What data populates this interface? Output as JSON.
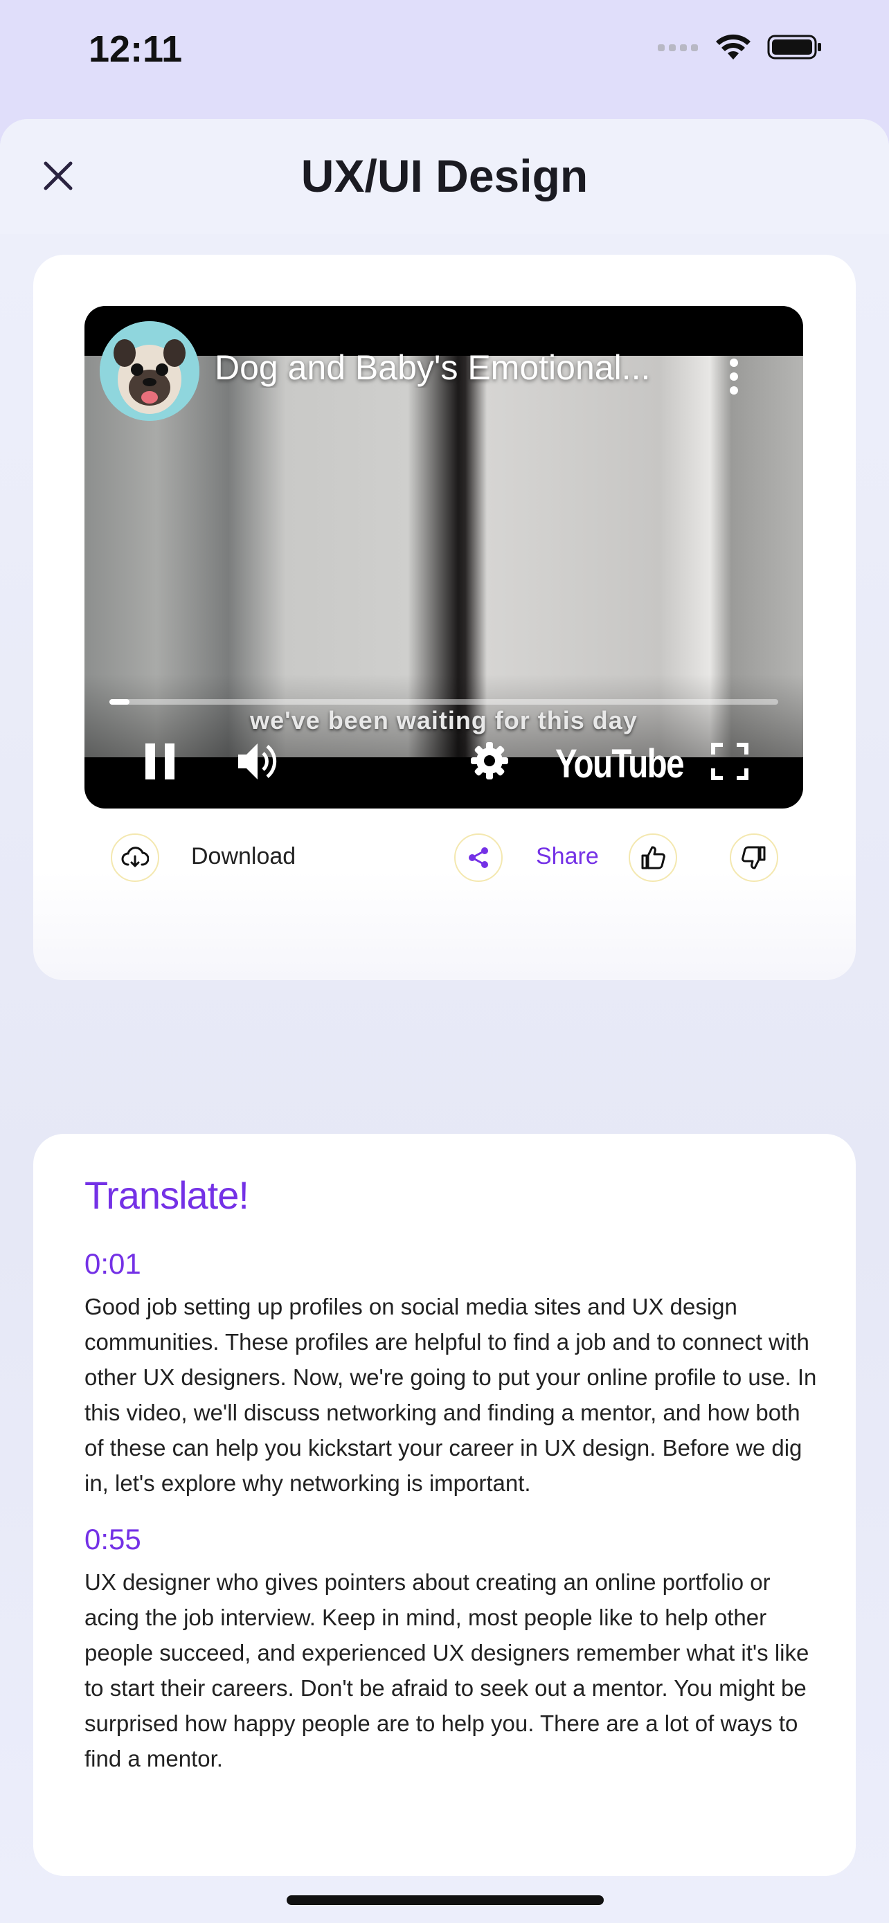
{
  "status_bar": {
    "time": "12:11"
  },
  "nav": {
    "title": "UX/UI Design",
    "close_icon": "close-icon"
  },
  "video": {
    "title": "Dog and Baby's Emotional...",
    "caption": "we've been waiting for this day",
    "brand": "YouTube",
    "progress": 0.03
  },
  "actions": {
    "download_label": "Download",
    "share_label": "Share"
  },
  "transcript": {
    "heading": "Translate!",
    "entries": [
      {
        "time": "0:01",
        "text": "Good job setting up profiles on social media sites and UX design communities. These profiles are helpful to find a job and to connect with other UX designers. Now, we're going to put your online profile to use. In this video, we'll discuss networking and finding a mentor, and how both of these can help you kickstart your career in UX design. Before we dig in, let's explore why networking is important."
      },
      {
        "time": "0:55",
        "text": "UX designer who gives pointers about creating an online portfolio or acing the job interview. Keep in mind, most people like to help other people succeed, and experienced UX designers remember what it's like to start their careers. Don't be afraid to seek out a mentor. You might be surprised how happy people are to help you. There are a lot of ways to find a mentor."
      }
    ]
  },
  "colors": {
    "accent": "#7431e6",
    "background": "#e0defa"
  }
}
